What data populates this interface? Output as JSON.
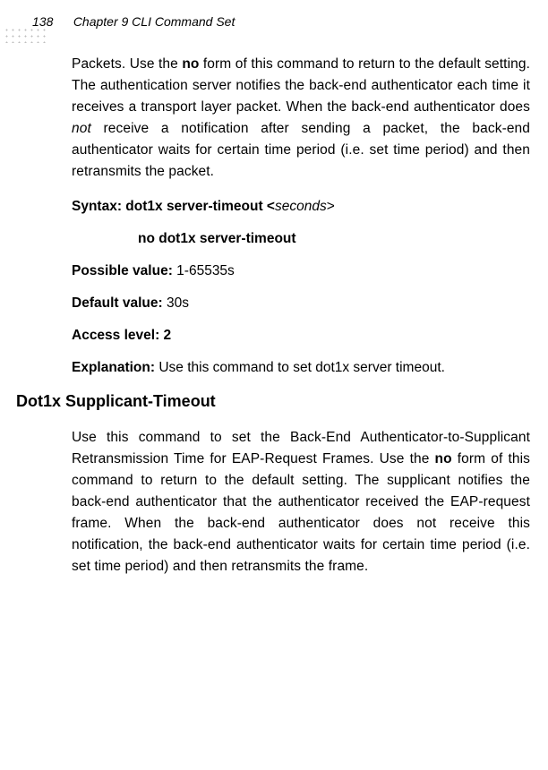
{
  "header": {
    "page_number": "138",
    "chapter": "Chapter 9 CLI Command Set"
  },
  "body": {
    "intro_para": {
      "p1": "Packets. Use the ",
      "no": "no",
      "p2": " form of this command to return to the default setting. The authentication server notifies the back-end authenticator each time it receives a transport layer packet. When the back-end authenticator does ",
      "not": "not",
      "p3": " receive a notification after sending a packet, the back-end authenticator waits for certain time period (i.e. set time period) and then retransmits the packet."
    },
    "syntax": {
      "label": "Syntax:  dot1x server-timeout  <",
      "arg": "seconds",
      "end": ">"
    },
    "no_line": "no dot1x server-timeout",
    "possible": {
      "label": "Possible value: ",
      "val": "1-65535s"
    },
    "default": {
      "label": "Default value: ",
      "val": "30s"
    },
    "access": {
      "label": "Access level: 2"
    },
    "explanation": {
      "label": "Explanation: ",
      "val": "Use this command to set dot1x server timeout."
    },
    "section_heading": "Dot1x Supplicant-Timeout",
    "second_para": {
      "p1": "Use this command to set the Back-End Authenticator-to-Supplicant Retransmission Time for EAP-Request Frames. Use the ",
      "no": "no",
      "p2": " form of this command to return to the default setting. The supplicant notifies the back-end authenticator that the authenticator received the EAP-request frame. When the back-end authenticator does not receive this notification, the back-end authenticator waits for certain time period (i.e. set time period) and then retransmits the frame."
    }
  }
}
